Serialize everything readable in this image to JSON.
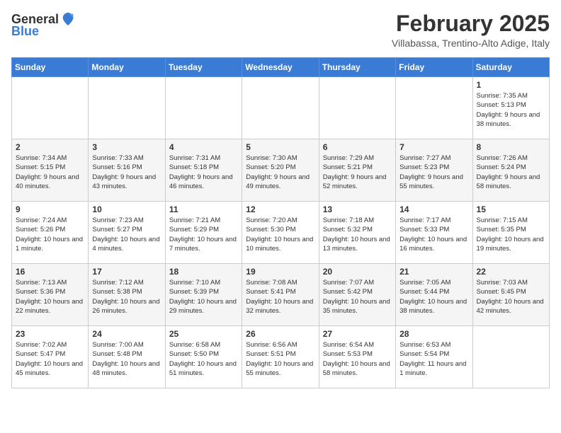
{
  "logo": {
    "general": "General",
    "blue": "Blue"
  },
  "title": "February 2025",
  "subtitle": "Villabassa, Trentino-Alto Adige, Italy",
  "weekdays": [
    "Sunday",
    "Monday",
    "Tuesday",
    "Wednesday",
    "Thursday",
    "Friday",
    "Saturday"
  ],
  "weeks": [
    [
      {
        "day": "",
        "info": ""
      },
      {
        "day": "",
        "info": ""
      },
      {
        "day": "",
        "info": ""
      },
      {
        "day": "",
        "info": ""
      },
      {
        "day": "",
        "info": ""
      },
      {
        "day": "",
        "info": ""
      },
      {
        "day": "1",
        "info": "Sunrise: 7:35 AM\nSunset: 5:13 PM\nDaylight: 9 hours and 38 minutes."
      }
    ],
    [
      {
        "day": "2",
        "info": "Sunrise: 7:34 AM\nSunset: 5:15 PM\nDaylight: 9 hours and 40 minutes."
      },
      {
        "day": "3",
        "info": "Sunrise: 7:33 AM\nSunset: 5:16 PM\nDaylight: 9 hours and 43 minutes."
      },
      {
        "day": "4",
        "info": "Sunrise: 7:31 AM\nSunset: 5:18 PM\nDaylight: 9 hours and 46 minutes."
      },
      {
        "day": "5",
        "info": "Sunrise: 7:30 AM\nSunset: 5:20 PM\nDaylight: 9 hours and 49 minutes."
      },
      {
        "day": "6",
        "info": "Sunrise: 7:29 AM\nSunset: 5:21 PM\nDaylight: 9 hours and 52 minutes."
      },
      {
        "day": "7",
        "info": "Sunrise: 7:27 AM\nSunset: 5:23 PM\nDaylight: 9 hours and 55 minutes."
      },
      {
        "day": "8",
        "info": "Sunrise: 7:26 AM\nSunset: 5:24 PM\nDaylight: 9 hours and 58 minutes."
      }
    ],
    [
      {
        "day": "9",
        "info": "Sunrise: 7:24 AM\nSunset: 5:26 PM\nDaylight: 10 hours and 1 minute."
      },
      {
        "day": "10",
        "info": "Sunrise: 7:23 AM\nSunset: 5:27 PM\nDaylight: 10 hours and 4 minutes."
      },
      {
        "day": "11",
        "info": "Sunrise: 7:21 AM\nSunset: 5:29 PM\nDaylight: 10 hours and 7 minutes."
      },
      {
        "day": "12",
        "info": "Sunrise: 7:20 AM\nSunset: 5:30 PM\nDaylight: 10 hours and 10 minutes."
      },
      {
        "day": "13",
        "info": "Sunrise: 7:18 AM\nSunset: 5:32 PM\nDaylight: 10 hours and 13 minutes."
      },
      {
        "day": "14",
        "info": "Sunrise: 7:17 AM\nSunset: 5:33 PM\nDaylight: 10 hours and 16 minutes."
      },
      {
        "day": "15",
        "info": "Sunrise: 7:15 AM\nSunset: 5:35 PM\nDaylight: 10 hours and 19 minutes."
      }
    ],
    [
      {
        "day": "16",
        "info": "Sunrise: 7:13 AM\nSunset: 5:36 PM\nDaylight: 10 hours and 22 minutes."
      },
      {
        "day": "17",
        "info": "Sunrise: 7:12 AM\nSunset: 5:38 PM\nDaylight: 10 hours and 26 minutes."
      },
      {
        "day": "18",
        "info": "Sunrise: 7:10 AM\nSunset: 5:39 PM\nDaylight: 10 hours and 29 minutes."
      },
      {
        "day": "19",
        "info": "Sunrise: 7:08 AM\nSunset: 5:41 PM\nDaylight: 10 hours and 32 minutes."
      },
      {
        "day": "20",
        "info": "Sunrise: 7:07 AM\nSunset: 5:42 PM\nDaylight: 10 hours and 35 minutes."
      },
      {
        "day": "21",
        "info": "Sunrise: 7:05 AM\nSunset: 5:44 PM\nDaylight: 10 hours and 38 minutes."
      },
      {
        "day": "22",
        "info": "Sunrise: 7:03 AM\nSunset: 5:45 PM\nDaylight: 10 hours and 42 minutes."
      }
    ],
    [
      {
        "day": "23",
        "info": "Sunrise: 7:02 AM\nSunset: 5:47 PM\nDaylight: 10 hours and 45 minutes."
      },
      {
        "day": "24",
        "info": "Sunrise: 7:00 AM\nSunset: 5:48 PM\nDaylight: 10 hours and 48 minutes."
      },
      {
        "day": "25",
        "info": "Sunrise: 6:58 AM\nSunset: 5:50 PM\nDaylight: 10 hours and 51 minutes."
      },
      {
        "day": "26",
        "info": "Sunrise: 6:56 AM\nSunset: 5:51 PM\nDaylight: 10 hours and 55 minutes."
      },
      {
        "day": "27",
        "info": "Sunrise: 6:54 AM\nSunset: 5:53 PM\nDaylight: 10 hours and 58 minutes."
      },
      {
        "day": "28",
        "info": "Sunrise: 6:53 AM\nSunset: 5:54 PM\nDaylight: 11 hours and 1 minute."
      },
      {
        "day": "",
        "info": ""
      }
    ]
  ]
}
